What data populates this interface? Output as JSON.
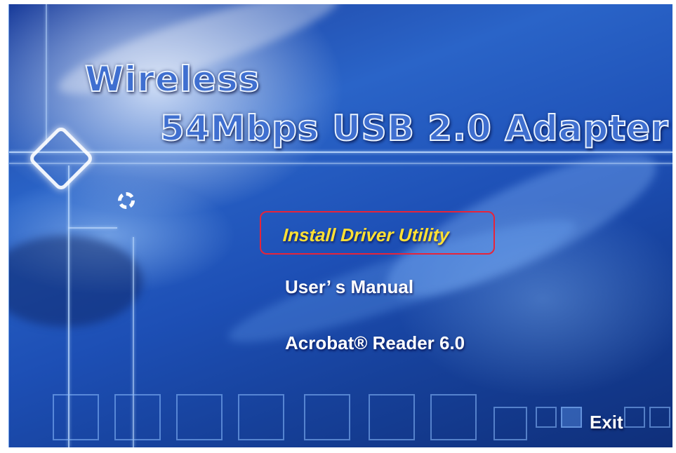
{
  "title": {
    "line1": "Wireless",
    "line2": "54Mbps USB 2.0 Adapter"
  },
  "menu": {
    "items": [
      {
        "label": "Install Driver Utility",
        "highlighted": true,
        "color": "#ffe033"
      },
      {
        "label": "User’ s Manual",
        "highlighted": false,
        "color": "#ffffff"
      },
      {
        "label": "Acrobat® Reader 6.0",
        "highlighted": false,
        "color": "#ffffff"
      }
    ],
    "highlight_border_color": "#e6243a"
  },
  "exit_label": "Exit",
  "icons": {
    "logo_ring": "dashed-circle-icon",
    "logo_diamond": "diamond-logo-icon"
  },
  "colors": {
    "background_primary": "#1d4fb5",
    "title_fill": "#3f6fd0",
    "title_outline": "#eaf3ff"
  }
}
